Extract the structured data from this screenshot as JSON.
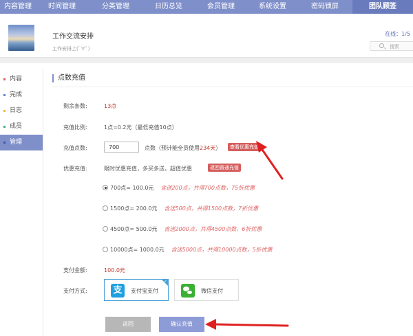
{
  "nav": {
    "tabs": [
      {
        "label": "内容管理"
      },
      {
        "label": "时间管理"
      },
      {
        "label": "分类管理"
      },
      {
        "label": "日历总览"
      },
      {
        "label": "会员管理"
      },
      {
        "label": "系统设置"
      },
      {
        "label": "密码锁屏"
      },
      {
        "label": "团队顾签"
      }
    ],
    "active": "团队顾签"
  },
  "header": {
    "title": "工作交流安排",
    "subtitle": "工作安排上(ﾟ∀ﾟ)",
    "online": "在线：1/5",
    "search_placeholder": "搜索"
  },
  "sidebar": {
    "items": [
      {
        "label": "内容",
        "color": "#e05b5b"
      },
      {
        "label": "完成",
        "color": "#5b7fd9"
      },
      {
        "label": "日志",
        "color": "#f0b840"
      },
      {
        "label": "成员",
        "color": "#3cb08a"
      },
      {
        "label": "管理",
        "color": "#3f56a8"
      }
    ],
    "active": "管理"
  },
  "section": {
    "title": "点数充值"
  },
  "form": {
    "remaining_label": "剩余条数:",
    "remaining_value": "13点",
    "ratio_label": "充值比例:",
    "ratio_value": "1点=0.2元（最低充值10点）",
    "points_label": "充值点数:",
    "points_input": "700",
    "points_hint_prefix": "点数（预计能全员使用",
    "points_days": "234天",
    "points_hint_suffix": "）",
    "view_offer_badge": "查看优惠充值",
    "offer_label": "优惠充值:",
    "offer_text": "限时优惠充值，多买多送，超值优惠",
    "quick_badge": "返回普通充值",
    "options": [
      {
        "main": "700点= 100.0元",
        "promo": "含送200点，共得700点数，75折优惠",
        "checked": true
      },
      {
        "main": "1500点= 200.0元",
        "promo": "含送500点，共得1500点数，7折优惠",
        "checked": false
      },
      {
        "main": "4500点= 500.0元",
        "promo": "含送2000点，共得4500点数，6折优惠",
        "checked": false
      },
      {
        "main": "10000点= 1000.0元",
        "promo": "含送5000点，共得10000点数，5折优惠",
        "checked": false
      }
    ],
    "amount_label": "支付金额:",
    "amount_value": "100.0元",
    "method_label": "支付方式:",
    "alipay_label": "支付宝支付",
    "alipay_glyph": "支",
    "wechat_label": "微信支付",
    "back_button": "返回",
    "confirm_button": "确认充值"
  },
  "colors": {
    "nav_bg": "#7f8fca",
    "accent": "#7f8fca",
    "badge": "#d65e5e",
    "arrow": "#e02020"
  }
}
